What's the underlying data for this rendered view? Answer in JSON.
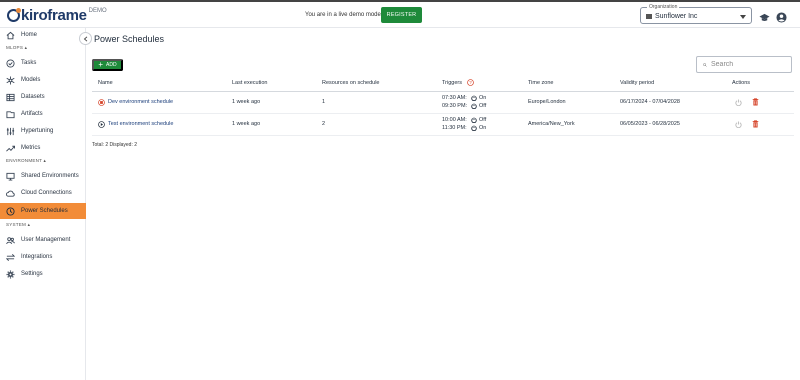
{
  "header": {
    "logo_text": "kiroframe",
    "logo_badge": "DEMO",
    "demo_message": "You are in a live demo mode",
    "register_label": "REGISTER",
    "org_label": "Organization",
    "org_value": "Sunflower Inc"
  },
  "sidebar": {
    "home": "Home",
    "mlops_section": "MLOPS",
    "mlops_items": [
      "Tasks",
      "Models",
      "Datasets",
      "Artifacts",
      "Hypertuning",
      "Metrics"
    ],
    "env_section": "ENVIRONMENT",
    "env_items": [
      "Shared Environments",
      "Cloud Connections",
      "Power Schedules"
    ],
    "system_section": "SYSTEM",
    "system_items": [
      "User Management",
      "Integrations",
      "Settings"
    ]
  },
  "main": {
    "title": "Power Schedules",
    "add_label": "ADD",
    "search_placeholder": "Search",
    "columns": [
      "Name",
      "Last execution",
      "Resources on schedule",
      "Triggers",
      "Time zone",
      "Validity period",
      "Actions"
    ],
    "rows": [
      {
        "name": "Dev environment schedule",
        "last_execution": "1 week ago",
        "resources": "1",
        "trigger1_time": "07:30 AM:",
        "trigger1_action": "On",
        "trigger2_time": "09:30 PM:",
        "trigger2_action": "Off",
        "timezone": "Europe/London",
        "validity": "06/17/2024 - 07/04/2028"
      },
      {
        "name": "Test environment schedule",
        "last_execution": "1 week ago",
        "resources": "2",
        "trigger1_time": "10:00 AM:",
        "trigger1_action": "Off",
        "trigger2_time": "11:30 PM:",
        "trigger2_action": "On",
        "timezone": "America/New_York",
        "validity": "06/05/2023 - 06/28/2025"
      }
    ],
    "footer": "Total: 2   Displayed: 2"
  },
  "colors": {
    "accent_orange": "#f28c38",
    "brand_green": "#1e8a3a",
    "brand_navy": "#1f3a68",
    "delete_red": "#d6452b"
  }
}
